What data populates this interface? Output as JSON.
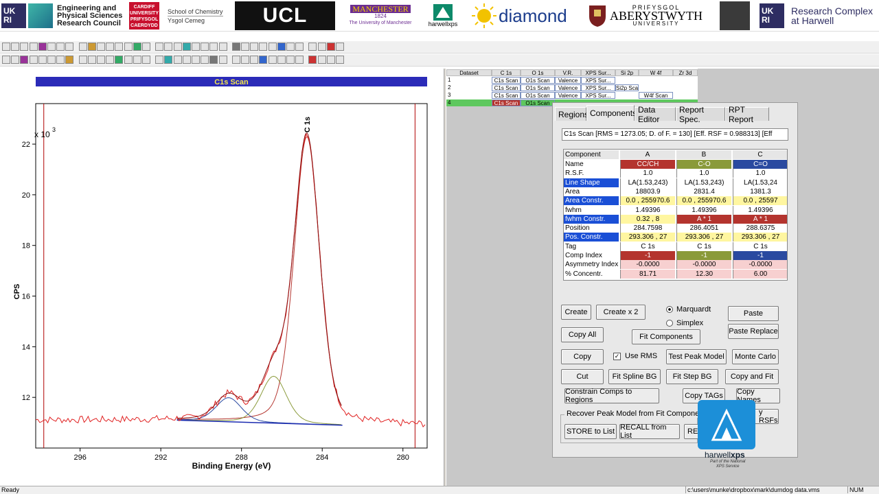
{
  "logos": {
    "ukri_left": "UK\nRI",
    "epsrc": [
      "Engineering and",
      "Physical Sciences",
      "Research Council"
    ],
    "cardiff": [
      "CARDIFF",
      "UNIVERSITY",
      "PRIFYSGOL",
      "CAERDYDD"
    ],
    "chemistry": [
      "School of Chemistry",
      "Ysgol Cemeg"
    ],
    "ucl": "UCL",
    "manchester": [
      "MANCHESTER",
      "1824",
      "The University of Manchester"
    ],
    "harwellxps": "harwellxps",
    "diamond": "diamond",
    "aberystwyth": [
      "PRIFYSGOL",
      "ABERYSTWYTH",
      "UNIVERSITY"
    ],
    "rc_harwell": [
      "Research Complex",
      "at Harwell"
    ]
  },
  "chart_title": "C1s Scan",
  "chart_data": {
    "type": "line",
    "title": "C1s Scan",
    "xlabel": "Binding Energy (eV)",
    "ylabel": "CPS",
    "y_multiplier": "x 10",
    "y_multiplier_exp": "3",
    "peak_label": "C 1s",
    "xlim": [
      298.2,
      278.8
    ],
    "ylim": [
      10.0,
      23.6
    ],
    "x_ticks": [
      296,
      292,
      288,
      284,
      280
    ],
    "x_tick_labels": [
      "296",
      "292",
      "288",
      "284",
      "280"
    ],
    "y_ticks": [
      12,
      14,
      16,
      18,
      20,
      22
    ],
    "y_tick_labels": [
      "12",
      "14",
      "16",
      "18",
      "20",
      "22"
    ],
    "region_markers_x": [
      297.8,
      279.4
    ],
    "background_range": [
      291.2,
      283.0
    ],
    "background_y": [
      11.1,
      10.9
    ],
    "components": [
      {
        "name": "CC/CH",
        "position": 284.7598,
        "fwhm": 1.49396,
        "height": 11.35,
        "color": "#b4342e"
      },
      {
        "name": "C-O",
        "position": 286.4051,
        "fwhm": 1.49396,
        "height": 1.85,
        "color": "#8a9a3a"
      },
      {
        "name": "C=O",
        "position": 288.6375,
        "fwhm": 1.49396,
        "height": 0.95,
        "color": "#2a4aa0"
      }
    ],
    "data_color": "#e02020",
    "envelope_color": "#8a1010",
    "background_color": "#1a2ab0"
  },
  "dataset_table": {
    "headers": [
      "Dataset",
      "C 1s",
      "O 1s",
      "V.R.",
      "XPS Sur...",
      "Si 2p",
      "W 4f",
      "Zr 3d"
    ],
    "rows": [
      [
        "1",
        "C1s Scan",
        "O1s Scan",
        "Valence",
        "XPS Sur...",
        "",
        "",
        ""
      ],
      [
        "2",
        "C1s Scan",
        "O1s Scan",
        "Valence",
        "XPS Sur...",
        "Si2p Scan",
        "",
        ""
      ],
      [
        "3",
        "C1s Scan",
        "O1s Scan",
        "Valence",
        "XPS Sur...",
        "",
        "W4f Scan",
        ""
      ],
      [
        "4",
        "C1s Scan",
        "O1s Scan",
        "",
        "",
        "",
        "",
        ""
      ]
    ]
  },
  "tabs": [
    "Regions",
    "Components",
    "Data Editor",
    "Report Spec.",
    "RPT Report"
  ],
  "active_tab": "Components",
  "fit_summary": "C1s Scan [RMS = 1273.05; D. of F. = 130] [Eff. RSF = 0.988313] [Eff",
  "comp_table": {
    "col_header": "Component",
    "columns": [
      "A",
      "B",
      "C"
    ],
    "rows": [
      {
        "label": "Name",
        "values": [
          "CC/CH",
          "C-O",
          "C=O"
        ],
        "style": "name"
      },
      {
        "label": "R.S.F.",
        "values": [
          "1.0",
          "1.0",
          "1.0"
        ],
        "style": "plain"
      },
      {
        "label": "Line Shape",
        "values": [
          "LA(1.53,243)",
          "LA(1.53,243)",
          "LA(1.53,24"
        ],
        "style": "plain",
        "hl": true
      },
      {
        "label": "Area",
        "values": [
          "18803.9",
          "2831.4",
          "1381.3"
        ],
        "style": "plain"
      },
      {
        "label": "Area Constr.",
        "values": [
          "0.0 , 255970.6",
          "0.0 , 255970.6",
          "0.0 , 25597"
        ],
        "style": "yellow",
        "hl": true
      },
      {
        "label": "fwhm",
        "values": [
          "1.49396",
          "1.49396",
          "1.49396"
        ],
        "style": "plain"
      },
      {
        "label": "fwhm Constr.",
        "values": [
          "0.32 , 8",
          "A * 1",
          "A * 1"
        ],
        "style": "constr",
        "hl": true
      },
      {
        "label": "Position",
        "values": [
          "284.7598",
          "286.4051",
          "288.6375"
        ],
        "style": "plain"
      },
      {
        "label": "Pos. Constr.",
        "values": [
          "293.306 , 27",
          "293.306 , 27",
          "293.306 , 27"
        ],
        "style": "yellow",
        "hl": true
      },
      {
        "label": "Tag",
        "values": [
          "C 1s",
          "C 1s",
          "C 1s"
        ],
        "style": "plain"
      },
      {
        "label": "Comp Index",
        "values": [
          "-1",
          "-1",
          "-1"
        ],
        "style": "name"
      },
      {
        "label": "Asymmetry Index",
        "values": [
          "-0.0000",
          "-0.0000",
          "-0.0000"
        ],
        "style": "pink"
      },
      {
        "label": "% Concentr.",
        "values": [
          "81.71",
          "12.30",
          "6.00"
        ],
        "style": "pink"
      }
    ]
  },
  "buttons": {
    "create": "Create",
    "create_x2": "Create x 2",
    "marquardt": "Marquardt",
    "simplex": "Simplex",
    "paste": "Paste",
    "copy_all": "Copy All",
    "fit_components": "Fit Components",
    "paste_replace": "Paste Replace",
    "copy": "Copy",
    "use_rms": "Use RMS",
    "test_peak_model": "Test Peak Model",
    "monte_carlo": "Monte Carlo",
    "cut": "Cut",
    "fit_spline_bg": "Fit Spline BG",
    "fit_step_bg": "Fit Step BG",
    "copy_and_fit": "Copy and Fit",
    "constrain_comps": "Constrain Comps to Regions",
    "copy_tags": "Copy TAGs",
    "copy_names": "Copy Names",
    "recover_group": "Recover Peak Model from Fit Components",
    "rsfs": "y RSFs",
    "store_to_list": "STORE to List",
    "recall_from_list": "RECALL from List",
    "re": "RE"
  },
  "overlay": {
    "brand": "harwell",
    "brand_bold": "xps",
    "tagline": [
      "Part of the National",
      "XPS Service"
    ]
  },
  "status": {
    "left": "Ready",
    "path": "c:\\users\\munke\\dropbox\\mark\\dumdog data.vms",
    "num": "NUM"
  },
  "colors": {
    "comp_a": "#b4342e",
    "comp_b": "#8a9a3a",
    "comp_c": "#2a4aa0",
    "title_bar": "#2b2bb8",
    "highlight": "#1a4fd6"
  }
}
